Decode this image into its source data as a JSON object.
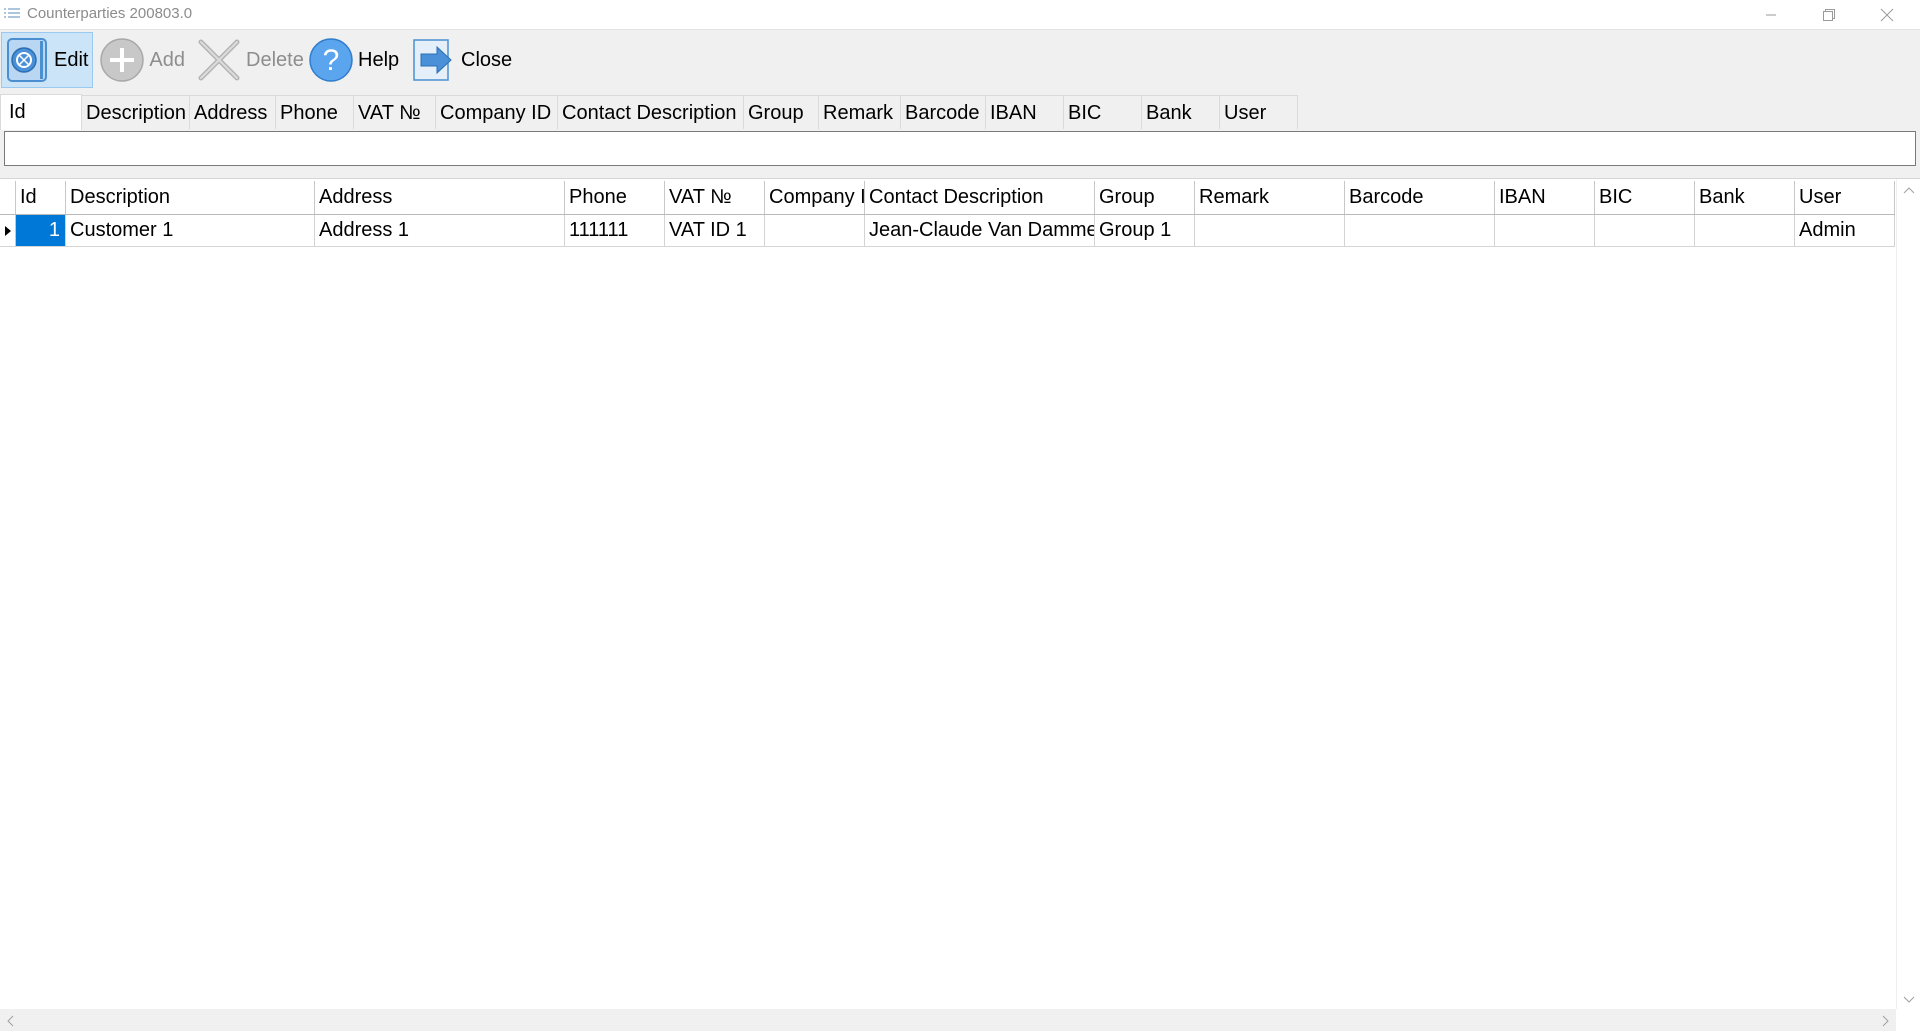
{
  "window": {
    "title": "Counterparties 200803.0",
    "controls": [
      "minimize-icon",
      "restore-icon",
      "close-icon"
    ]
  },
  "toolbar": {
    "edit_label": "Edit",
    "add_label": "Add",
    "delete_label": "Delete",
    "help_label": "Help",
    "close_label": "Close"
  },
  "search": {
    "tabs": [
      "Id",
      "Description",
      "Address",
      "Phone",
      "VAT №",
      "Company ID",
      "Contact Description",
      "Group",
      "Remark",
      "Barcode",
      "IBAN",
      "BIC",
      "Bank",
      "User"
    ],
    "active_tab": "Id",
    "value": ""
  },
  "grid": {
    "columns": [
      "Id",
      "Description",
      "Address",
      "Phone",
      "VAT №",
      "Company I",
      "Contact Description",
      "Group",
      "Remark",
      "Barcode",
      "IBAN",
      "BIC",
      "Bank",
      "User"
    ],
    "rows": [
      [
        "1",
        "Customer 1",
        "Address 1",
        "111111",
        "VAT ID 1",
        "",
        "Jean-Claude Van Damme",
        "Group 1",
        "",
        "",
        "",
        "",
        "",
        "Admin"
      ]
    ],
    "selected_color": "#0078d7"
  },
  "colors": {
    "accent": "#0078d7",
    "toolbar_active_bg": "#cce4f7",
    "disabled_text": "#8d8d8d"
  }
}
